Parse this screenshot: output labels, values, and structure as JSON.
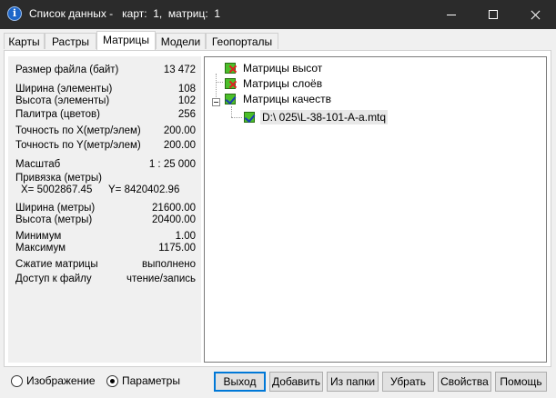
{
  "window": {
    "title": "Список данных -   карт:  1,  матриц:  1"
  },
  "tabs": [
    {
      "label": "Карты"
    },
    {
      "label": "Растры"
    },
    {
      "label": "Матрицы"
    },
    {
      "label": "Модели"
    },
    {
      "label": "Геопорталы"
    }
  ],
  "active_tab": "Матрицы",
  "properties": {
    "file_size": {
      "label": "Размер файла (байт)",
      "value": "13 472"
    },
    "width_el": {
      "label": "Ширина (элементы)",
      "value": "108"
    },
    "height_el": {
      "label": "Высота (элементы)",
      "value": "102"
    },
    "palette": {
      "label": "Палитра (цветов)",
      "value": "256"
    },
    "precision_x": {
      "label": "Точность по X(метр/элем)",
      "value": "200.00"
    },
    "precision_y": {
      "label": "Точность по Y(метр/элем)",
      "value": "200.00"
    },
    "scale": {
      "label": "Масштаб",
      "value": "1 : 25 000"
    },
    "binding": {
      "label": "Привязка (метры)",
      "x": "X= 5002867.45",
      "y": "Y= 8420402.96"
    },
    "width_m": {
      "label": "Ширина (метры)",
      "value": "21600.00"
    },
    "height_m": {
      "label": "Высота (метры)",
      "value": "20400.00"
    },
    "minimum": {
      "label": "Минимум",
      "value": "1.00"
    },
    "maximum": {
      "label": "Максимум",
      "value": "1175.00"
    },
    "compression": {
      "label": "Сжатие матрицы",
      "value": "выполнено"
    },
    "access": {
      "label": "Доступ к файлу",
      "value": "чтение/запись"
    }
  },
  "tree": {
    "heights": "Матрицы высот",
    "layers": "Матрицы слоёв",
    "quality": "Матрицы качеств",
    "quality_file": "D:\\ 025\\L-38-101-A-a.mtq"
  },
  "view_mode": {
    "image": "Изображение",
    "params": "Параметры",
    "selected": "Параметры"
  },
  "buttons": {
    "exit": "Выход",
    "add": "Добавить",
    "from_folder": "Из папки",
    "remove": "Убрать",
    "properties": "Свойства",
    "help": "Помощь"
  }
}
